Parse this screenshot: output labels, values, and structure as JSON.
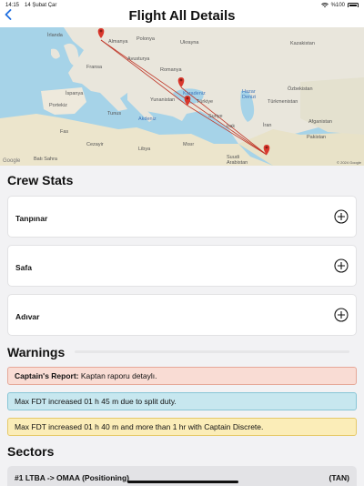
{
  "status_bar": {
    "time": "14:15",
    "date": "14 Şubat Çar",
    "battery": "%100"
  },
  "nav": {
    "back_icon": "chevron-left-icon",
    "title": "Flight All Details"
  },
  "map": {
    "labels": {
      "irlanda": "İrlanda",
      "almanya": "Almanya",
      "polonya": "Polonya",
      "ukrayna": "Ukrayna",
      "kazakistan": "Kazakistan",
      "avusturya": "Avusturya",
      "fransa": "Fransa",
      "romanya": "Romanya",
      "ozbekistan": "Özbekistan",
      "ispanya": "İspanya",
      "yunanistan": "Yunanistan",
      "turkiye": "Türkiye",
      "turkmenistan": "Türkmenistan",
      "portekiz": "Portekiz",
      "tunus": "Tunus",
      "suriye": "Suriye",
      "irak": "Irak",
      "iran": "İran",
      "fas": "Fas",
      "cezayir": "Cezayir",
      "libya": "Libya",
      "misir": "Mısır",
      "afganistan": "Afganistan",
      "pakistan": "Pakistan",
      "batisahra": "Batı Sahra",
      "suudi": "Suudi\nArabistan",
      "akdeniz": "Akdeniz",
      "karadeniz": "Karadeniz",
      "hazar": "Hazar\nDenizi"
    },
    "attribution": "Google",
    "copyright": "© 2024 Google"
  },
  "crew_stats": {
    "title": "Crew Stats",
    "members": [
      {
        "name": "Tanpınar"
      },
      {
        "name": "Safa"
      },
      {
        "name": "Adıvar"
      }
    ]
  },
  "warnings": {
    "title": "Warnings",
    "items": [
      {
        "label": "Captain's Report:",
        "text": " Kaptan raporu detaylı.",
        "color": "#f9dcd4"
      },
      {
        "text": "Max FDT increased 01 h 45 m due to split duty.",
        "color": "#c7e7ef"
      },
      {
        "text": "Max FDT increased 01 h 40 m and more than 1 hr with Captain Discrete.",
        "color": "#fbedb8"
      }
    ]
  },
  "sectors": {
    "title": "Sectors",
    "items": [
      {
        "route": "#1 LTBA -> OMAA (Positioning)",
        "code": "(TAN)"
      }
    ]
  }
}
